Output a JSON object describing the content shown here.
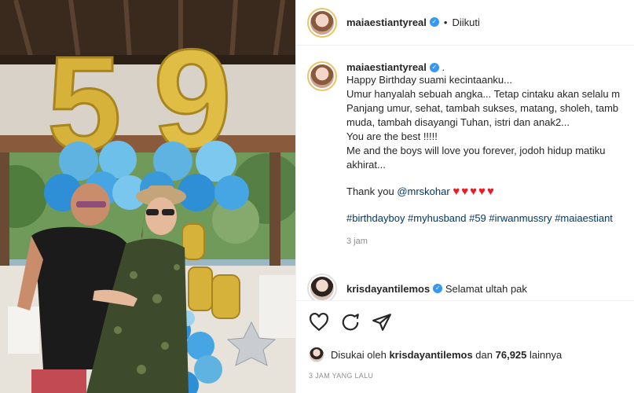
{
  "photo": {
    "alt": "Birthday photo with number 59 balloons",
    "balloon_number_left": "5",
    "balloon_number_right": "9"
  },
  "header": {
    "username": "maiaestiantyreal",
    "verified_icon": "verified-badge-icon",
    "separator": "•",
    "follow_state": "Diikuti"
  },
  "caption": {
    "username": "maiaestiantyreal",
    "head_suffix": ".",
    "lines": [
      "Happy Birthday suami kecintaanku...",
      "Umur hanyalah sebuah angka... Tetap cintaku akan selalu m",
      "Panjang umur, sehat, tambah sukses, matang, sholeh, tamb",
      "muda, tambah disayangi Tuhan, istri dan anak2...",
      "You are the best !!!!!",
      "Me and the boys will love you forever, jodoh hidup matiku",
      "akhirat..."
    ],
    "thanks_prefix": "Thank you ",
    "thanks_mention": "@mrskohar",
    "hearts": "♥♥♥♥♥",
    "hashtags": "#birthdayboy #myhusband #59 #irwanmussry #maiaestiant",
    "time": "3 jam"
  },
  "comment": {
    "username": "krisdayantilemos",
    "text": "Selamat ultah pak"
  },
  "actions": {
    "like_icon": "heart-icon",
    "comment_icon": "comment-icon",
    "share_icon": "share-icon"
  },
  "likes": {
    "prefix": "Disukai oleh ",
    "user": "krisdayantilemos",
    "middle": " dan ",
    "count": "76,925",
    "suffix": " lainnya"
  },
  "timestamp": "3 JAM YANG LALU",
  "colors": {
    "accent_blue": "#3897f0",
    "link": "#00376b",
    "heart_red": "#ed1c24",
    "muted": "#8e8e8e"
  }
}
